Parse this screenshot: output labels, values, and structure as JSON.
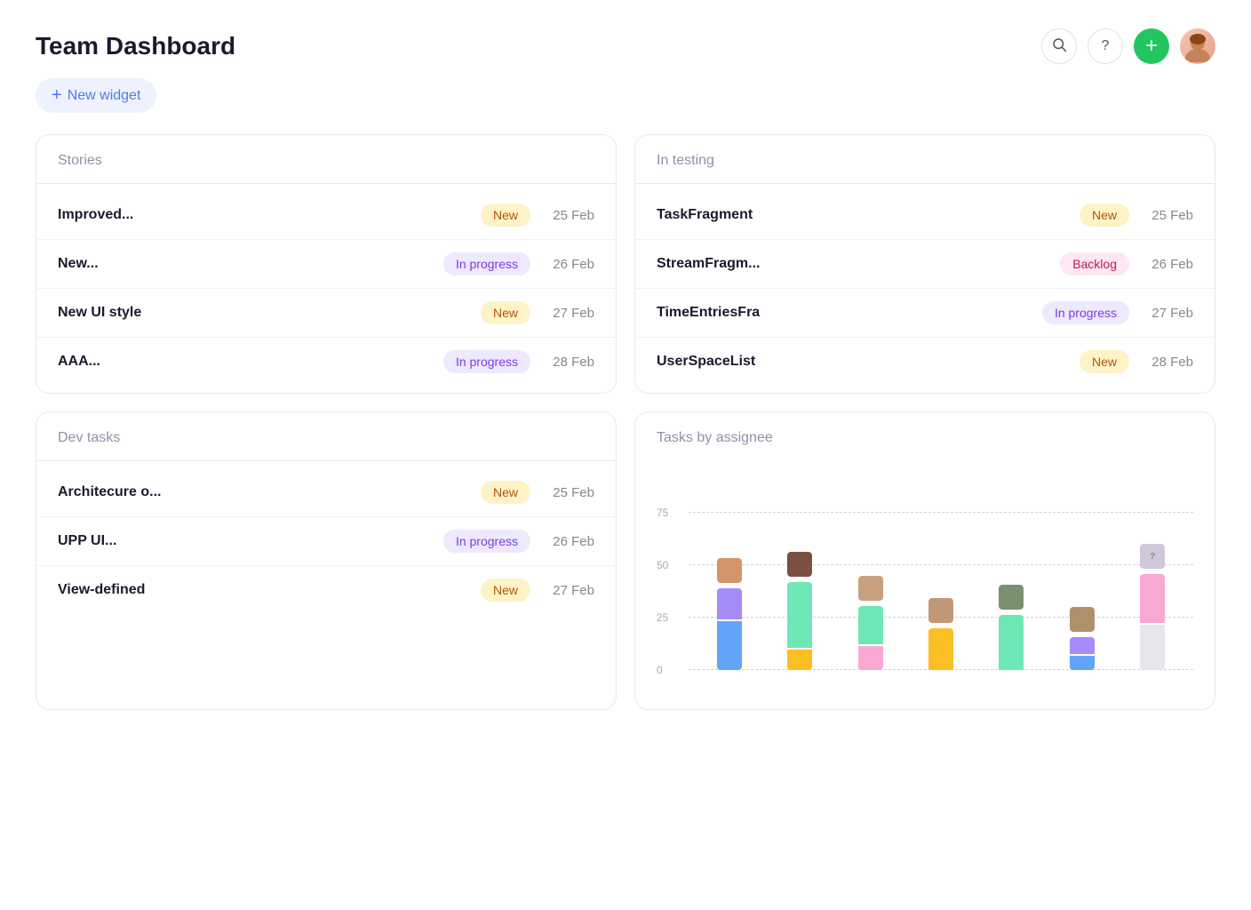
{
  "header": {
    "title": "Team Dashboard",
    "new_widget_label": "New widget",
    "new_widget_plus": "+",
    "search_icon": "search",
    "help_icon": "?",
    "add_icon": "+"
  },
  "stories": {
    "title": "Stories",
    "items": [
      {
        "name": "Improved...",
        "badge": "New",
        "badge_type": "new",
        "date": "25 Feb"
      },
      {
        "name": "New...",
        "badge": "In progress",
        "badge_type": "inprogress",
        "date": "26 Feb"
      },
      {
        "name": "New UI style",
        "badge": "New",
        "badge_type": "new",
        "date": "27 Feb"
      },
      {
        "name": "AAA...",
        "badge": "In progress",
        "badge_type": "inprogress",
        "date": "28 Feb"
      }
    ]
  },
  "in_testing": {
    "title": "In testing",
    "items": [
      {
        "name": "TaskFragment",
        "badge": "New",
        "badge_type": "new",
        "date": "25 Feb"
      },
      {
        "name": "StreamFragm...",
        "badge": "Backlog",
        "badge_type": "backlog",
        "date": "26 Feb"
      },
      {
        "name": "TimeEntriesFra",
        "badge": "In progress",
        "badge_type": "inprogress",
        "date": "27 Feb"
      },
      {
        "name": "UserSpaceList",
        "badge": "New",
        "badge_type": "new",
        "date": "28 Feb"
      }
    ]
  },
  "dev_tasks": {
    "title": "Dev tasks",
    "items": [
      {
        "name": "Architecure o...",
        "badge": "New",
        "badge_type": "new",
        "date": "25 Feb"
      },
      {
        "name": "UPP UI...",
        "badge": "In progress",
        "badge_type": "inprogress",
        "date": "26 Feb"
      },
      {
        "name": "View-defined",
        "badge": "New",
        "badge_type": "new",
        "date": "27 Feb"
      }
    ]
  },
  "tasks_by_assignee": {
    "title": "Tasks by assignee",
    "y_labels": [
      "75",
      "50",
      "25",
      "0"
    ],
    "bars": [
      {
        "avatar_color": "#c8a080",
        "segments": [
          {
            "color": "#a78bfa",
            "height_pct": 18
          },
          {
            "color": "#6ee7b7",
            "height_pct": 0
          },
          {
            "color": "#fbbf24",
            "height_pct": 0
          },
          {
            "color": "#60a5fa",
            "height_pct": 28
          }
        ]
      },
      {
        "avatar_color": "#8a6a5a",
        "segments": [
          {
            "color": "#a78bfa",
            "height_pct": 0
          },
          {
            "color": "#6ee7b7",
            "height_pct": 38
          },
          {
            "color": "#fbbf24",
            "height_pct": 12
          },
          {
            "color": "#60a5fa",
            "height_pct": 0
          }
        ]
      },
      {
        "avatar_color": "#b09080",
        "segments": [
          {
            "color": "#a78bfa",
            "height_pct": 0
          },
          {
            "color": "#6ee7b7",
            "height_pct": 22
          },
          {
            "color": "#fbbf24",
            "height_pct": 0
          },
          {
            "color": "#f9a8d4",
            "height_pct": 14
          }
        ]
      },
      {
        "avatar_color": "#c0a090",
        "segments": [
          {
            "color": "#a78bfa",
            "height_pct": 0
          },
          {
            "color": "#6ee7b7",
            "height_pct": 0
          },
          {
            "color": "#fbbf24",
            "height_pct": 24
          },
          {
            "color": "#60a5fa",
            "height_pct": 0
          }
        ]
      },
      {
        "avatar_color": "#7a9080",
        "segments": [
          {
            "color": "#a78bfa",
            "height_pct": 0
          },
          {
            "color": "#6ee7b7",
            "height_pct": 32
          },
          {
            "color": "#fbbf24",
            "height_pct": 0
          },
          {
            "color": "#60a5fa",
            "height_pct": 0
          }
        ]
      },
      {
        "avatar_color": "#a09070",
        "segments": [
          {
            "color": "#a78bfa",
            "height_pct": 10
          },
          {
            "color": "#6ee7b7",
            "height_pct": 0
          },
          {
            "color": "#fbbf24",
            "height_pct": 0
          },
          {
            "color": "#60a5fa",
            "height_pct": 8
          }
        ]
      },
      {
        "avatar_color": "#e0d0e0",
        "avatar_label": "?",
        "segments": [
          {
            "color": "#f9a8d4",
            "height_pct": 28
          },
          {
            "color": "#e5e7eb",
            "height_pct": 26
          }
        ]
      }
    ]
  }
}
